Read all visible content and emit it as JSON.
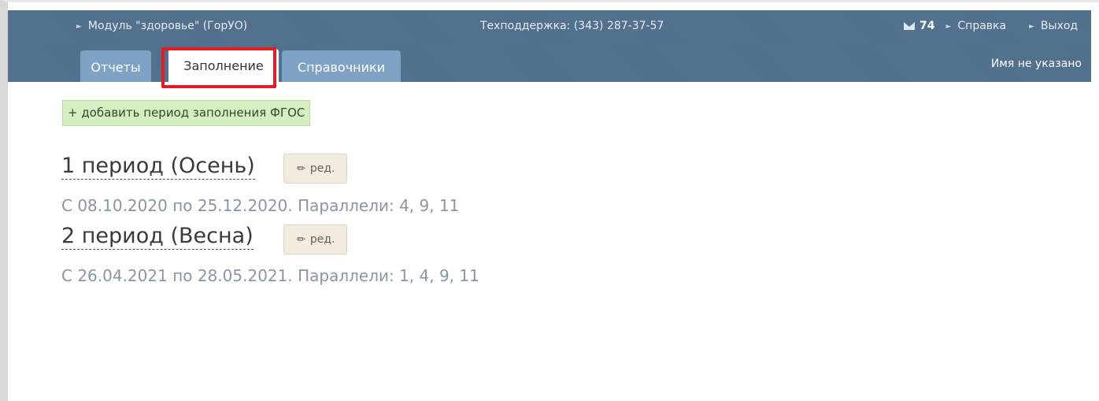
{
  "header": {
    "module_label": "Модуль \"здоровье\" (ГорУО)",
    "support_label": "Техподдержка: (343) 287-37-57",
    "mail_count": "74",
    "help_label": "Справка",
    "logout_label": "Выход"
  },
  "tabs": [
    {
      "label": "Отчеты"
    },
    {
      "label": "Заполнение"
    },
    {
      "label": "Справочники"
    }
  ],
  "user_name": "Имя не указано",
  "add_period_label": "+ добавить период заполнения ФГОС",
  "periods": [
    {
      "title": "1 период (Осень)",
      "edit_label": "ред.",
      "info": "С 08.10.2020 по 25.12.2020. Параллели: 4, 9, 11"
    },
    {
      "title": "2 период (Весна)",
      "edit_label": "ред.",
      "info": "С 26.04.2021 по 28.05.2021. Параллели: 1, 4, 9, 11"
    }
  ]
}
